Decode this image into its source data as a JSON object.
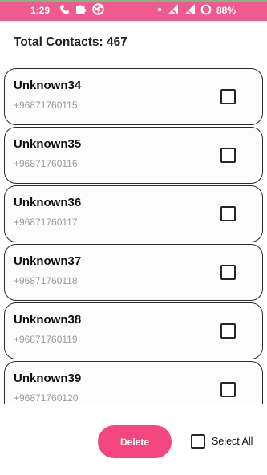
{
  "status_bar": {
    "time": "1:29",
    "battery_text": "88%",
    "left_icons": [
      "phone-icon",
      "puzzle-icon",
      "chrome-icon"
    ],
    "right_icons": [
      "dot-icon",
      "wifi-off-icon",
      "signal-off-icon",
      "battery-icon"
    ]
  },
  "header": {
    "total_text": "Total Contacts: 467"
  },
  "contacts": [
    {
      "name": "Unknown34",
      "phone": "+96871760115",
      "checked": false
    },
    {
      "name": "Unknown35",
      "phone": "+96871760116",
      "checked": false
    },
    {
      "name": "Unknown36",
      "phone": "+96871760117",
      "checked": false
    },
    {
      "name": "Unknown37",
      "phone": "+96871760118",
      "checked": false
    },
    {
      "name": "Unknown38",
      "phone": "+96871760119",
      "checked": false
    },
    {
      "name": "Unknown39",
      "phone": "+96871760120",
      "checked": false
    }
  ],
  "footer": {
    "delete_label": "Delete",
    "select_all_label": "Select All",
    "select_all_checked": false
  },
  "colors": {
    "status_bar": "#f05a8c",
    "delete_button": "#f4467f",
    "phone_text": "#9a9a9a"
  }
}
